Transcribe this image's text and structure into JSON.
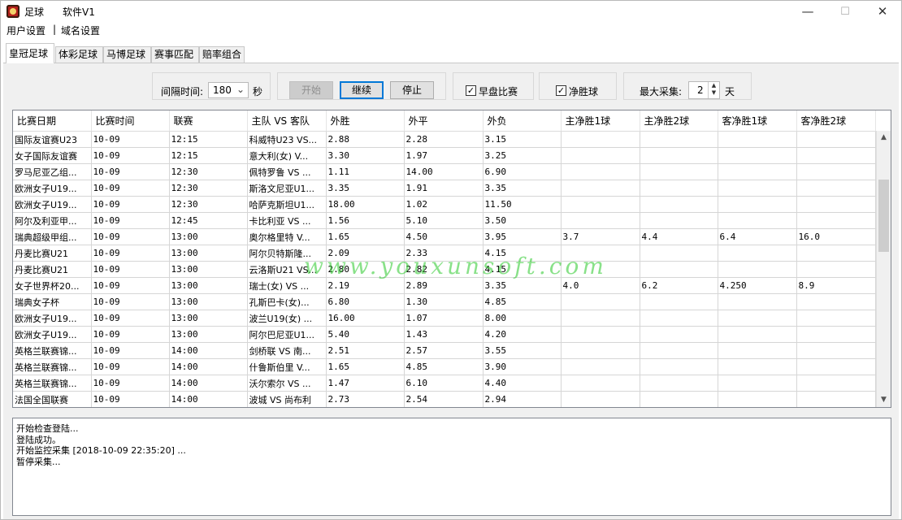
{
  "window": {
    "app_name": "足球",
    "version_title": "软件V1",
    "minimize_glyph": "—",
    "maximize_glyph": "☐",
    "close_glyph": "✕"
  },
  "menu": {
    "user_settings": "用户设置",
    "separator": "|",
    "domain_settings": "域名设置"
  },
  "tabs": [
    "皇冠足球",
    "体彩足球",
    "马博足球",
    "赛事匹配",
    "赔率组合"
  ],
  "controls": {
    "interval_label": "间隔时间:",
    "interval_value": "180",
    "interval_unit": "秒",
    "start_label": "开始",
    "continue_label": "继续",
    "stop_label": "停止",
    "early_match_label": "早盘比赛",
    "early_match_checked": true,
    "net_win_label": "净胜球",
    "net_win_checked": true,
    "max_collect_label": "最大采集:",
    "max_collect_value": "2",
    "max_collect_unit": "天"
  },
  "table": {
    "columns": [
      "比赛日期",
      "比赛时间",
      "联赛",
      "主队 VS 客队",
      "外胜",
      "外平",
      "外负",
      "主净胜1球",
      "主净胜2球",
      "客净胜1球",
      "客净胜2球"
    ],
    "rows": [
      [
        "国际友谊赛U23",
        "10-09",
        "12:15",
        "科威特U23 VS...",
        "2.88",
        "2.28",
        "3.15",
        "",
        "",
        "",
        ""
      ],
      [
        "女子国际友谊赛",
        "10-09",
        "12:15",
        "意大利(女) V...",
        "3.30",
        "1.97",
        "3.25",
        "",
        "",
        "",
        ""
      ],
      [
        "罗马尼亚乙组...",
        "10-09",
        "12:30",
        "佩特罗鲁 VS ...",
        "1.11",
        "14.00",
        "6.90",
        "",
        "",
        "",
        ""
      ],
      [
        "欧洲女子U19...",
        "10-09",
        "12:30",
        "斯洛文尼亚U1...",
        "3.35",
        "1.91",
        "3.35",
        "",
        "",
        "",
        ""
      ],
      [
        "欧洲女子U19...",
        "10-09",
        "12:30",
        "哈萨克斯坦U1...",
        "18.00",
        "1.02",
        "11.50",
        "",
        "",
        "",
        ""
      ],
      [
        "阿尔及利亚甲...",
        "10-09",
        "12:45",
        "卡比利亚 VS ...",
        "1.56",
        "5.10",
        "3.50",
        "",
        "",
        "",
        ""
      ],
      [
        "瑞典超级甲组...",
        "10-09",
        "13:00",
        "奥尔格里特 V...",
        "1.65",
        "4.50",
        "3.95",
        "3.7",
        "4.4",
        "6.4",
        "16.0"
      ],
      [
        "丹麦比赛U21",
        "10-09",
        "13:00",
        "阿尔贝特斯隆...",
        "2.09",
        "2.33",
        "4.15",
        "",
        "",
        "",
        ""
      ],
      [
        "丹麦比赛U21",
        "10-09",
        "13:00",
        "云洛斯U21 VS...",
        "2.80",
        "2.82",
        "4.15",
        "",
        "",
        "",
        ""
      ],
      [
        "女子世界杯20...",
        "10-09",
        "13:00",
        "瑞士(女) VS ...",
        "2.19",
        "2.89",
        "3.35",
        "4.0",
        "6.2",
        "4.250",
        "8.9"
      ],
      [
        "瑞典女子杯",
        "10-09",
        "13:00",
        "孔斯巴卡(女)...",
        "6.80",
        "1.30",
        "4.85",
        "",
        "",
        "",
        ""
      ],
      [
        "欧洲女子U19...",
        "10-09",
        "13:00",
        "波兰U19(女) ...",
        "16.00",
        "1.07",
        "8.00",
        "",
        "",
        "",
        ""
      ],
      [
        "欧洲女子U19...",
        "10-09",
        "13:00",
        "阿尔巴尼亚U1...",
        "5.40",
        "1.43",
        "4.20",
        "",
        "",
        "",
        ""
      ],
      [
        "英格兰联赛锦...",
        "10-09",
        "14:00",
        "剑桥联 VS 南...",
        "2.51",
        "2.57",
        "3.55",
        "",
        "",
        "",
        ""
      ],
      [
        "英格兰联赛锦...",
        "10-09",
        "14:00",
        "什鲁斯伯里 V...",
        "1.65",
        "4.85",
        "3.90",
        "",
        "",
        "",
        ""
      ],
      [
        "英格兰联赛锦...",
        "10-09",
        "14:00",
        "沃尔索尔 VS ...",
        "1.47",
        "6.10",
        "4.40",
        "",
        "",
        "",
        ""
      ],
      [
        "法国全国联赛",
        "10-09",
        "14:00",
        "波城 VS 尚布利",
        "2.73",
        "2.54",
        "2.94",
        "",
        "",
        "",
        ""
      ]
    ]
  },
  "watermark": "www.youxunsoft.com",
  "log": [
    "开始检查登陆...",
    "登陆成功。",
    "开始监控采集 [2018-10-09 22:35:20] ...",
    "暂停采集..."
  ],
  "colors": {
    "focus_border": "#0078d7",
    "watermark": "#28c828"
  }
}
